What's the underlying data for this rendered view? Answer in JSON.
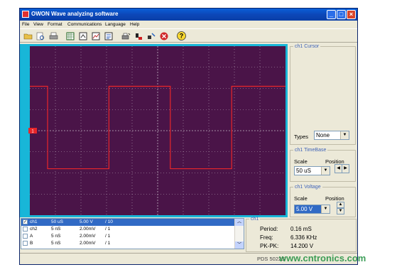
{
  "window": {
    "title": "OWON Wave analyzing software",
    "min": "_",
    "max": "□",
    "close": "×"
  },
  "menu": [
    "File",
    "View",
    "Format",
    "Communications",
    "Language",
    "Help"
  ],
  "toolbar_icons": [
    "open-icon",
    "print-preview-icon",
    "print-icon",
    "table-icon",
    "export-icon",
    "chart-icon",
    "calculator-icon",
    "print-setup-icon",
    "connect-icon",
    "disconnect-icon",
    "stop-icon",
    "help-icon"
  ],
  "scope": {
    "trace_color": "#e8262a",
    "grid_color": "#b8a8b8",
    "background": "#4a1448",
    "ch1_marker": "1",
    "waveform": {
      "period_divisions": 4.8,
      "high_div": 2.1,
      "low_div": -1.8
    }
  },
  "cursor": {
    "legend": "ch1 Cursor",
    "types_label": "Types",
    "types_value": "None"
  },
  "timebase": {
    "legend": "ch1 TimeBase",
    "scale_label": "Scale",
    "position_label": "Position",
    "scale_value": "50 uS"
  },
  "voltage": {
    "legend": "ch1 Voltage",
    "scale_label": "Scale",
    "position_label": "Position",
    "scale_value": "5.00 V"
  },
  "channels": [
    {
      "name": "ch1",
      "time": "50 uS",
      "volt": "5.00 V",
      "probe": "/ 10",
      "checked": true,
      "selected": true
    },
    {
      "name": "ch2",
      "time": "5 nS",
      "volt": "2.00mV",
      "probe": "/ 1",
      "checked": false,
      "selected": false
    },
    {
      "name": "A",
      "time": "5 nS",
      "volt": "2.00mV",
      "probe": "/ 1",
      "checked": false,
      "selected": false
    },
    {
      "name": "B",
      "time": "5 nS",
      "volt": "2.00mV",
      "probe": "/ 1",
      "checked": false,
      "selected": false
    }
  ],
  "measure": {
    "legend": "ch1",
    "period_label": "Period:",
    "period_value": "0.16 mS",
    "freq_label": "Freq:",
    "freq_value": "6.336 KHz",
    "pkpk_label": "PK-PK:",
    "pkpk_value": "14.200 V"
  },
  "status": {
    "model": "PDS 5022S"
  },
  "watermark": "www.cntronics.com"
}
